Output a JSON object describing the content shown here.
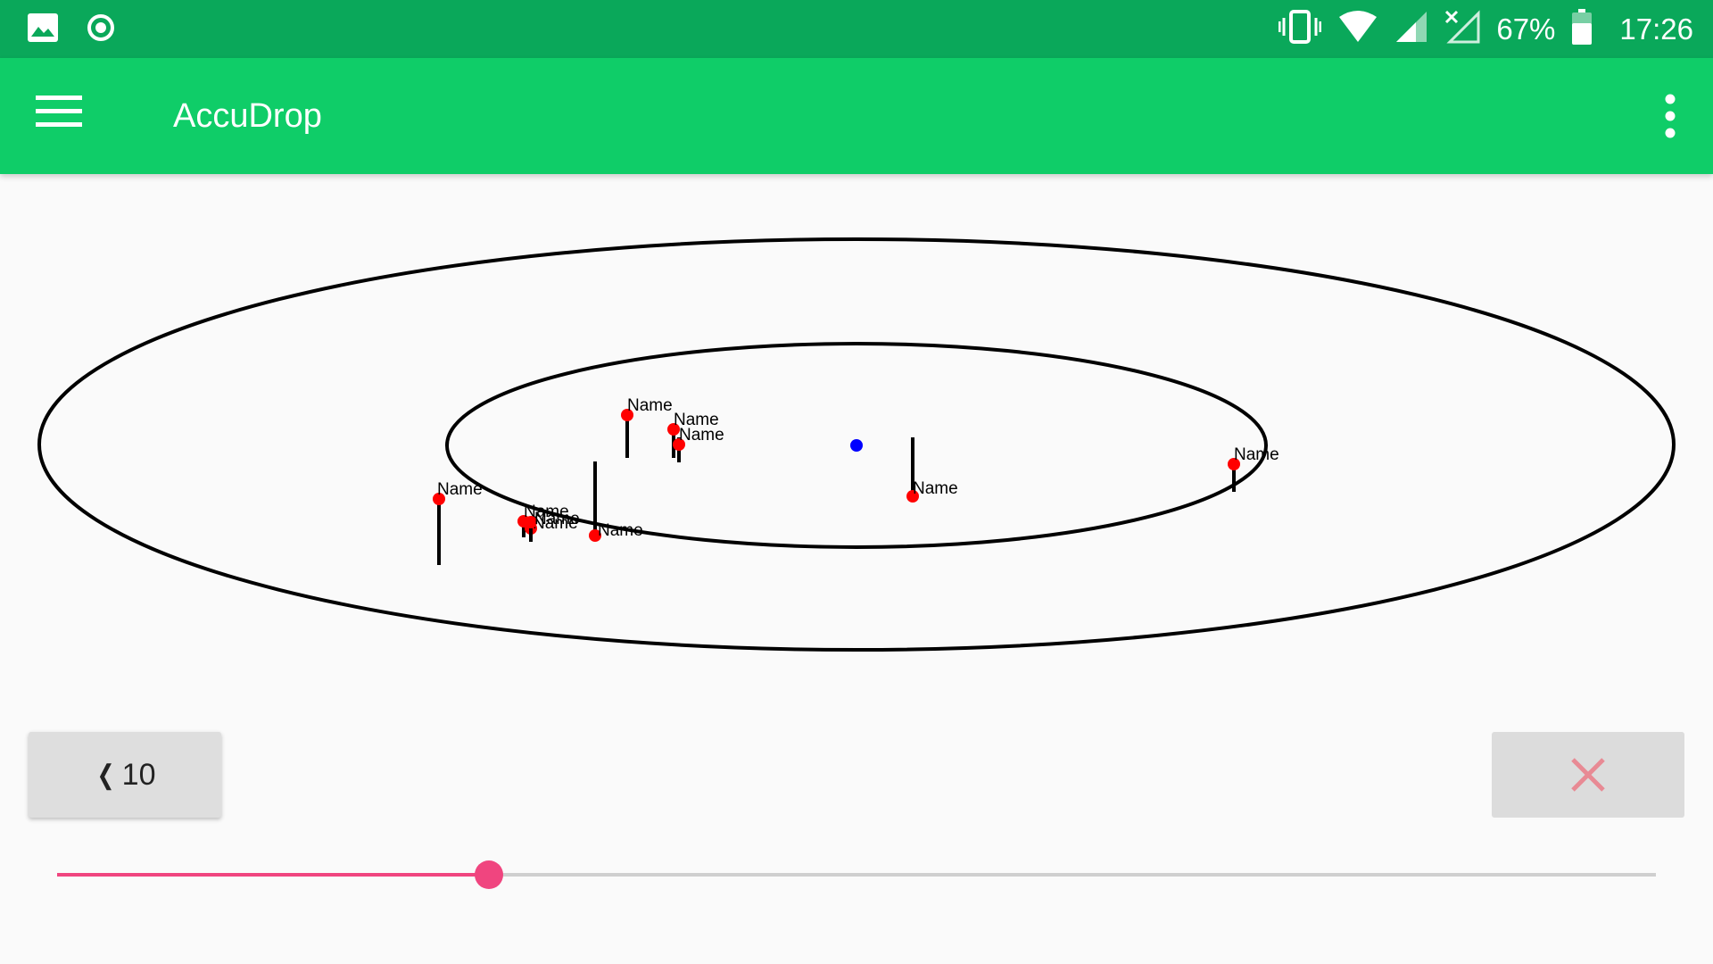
{
  "status_bar": {
    "battery": "67%",
    "time": "17:26",
    "icons": [
      "image-icon",
      "record-icon",
      "vibrate-icon",
      "wifi-icon",
      "cell-signal-icon",
      "no-signal-icon",
      "battery-icon"
    ]
  },
  "app_bar": {
    "title": "AccuDrop",
    "icons": [
      "menu-icon",
      "more-vert-icon"
    ]
  },
  "target": {
    "center_color": "#0000ff",
    "drop_color": "#ff0000",
    "drops": [
      {
        "label": "Name"
      },
      {
        "label": "Name"
      },
      {
        "label": "Name"
      },
      {
        "label": "Name"
      },
      {
        "label": "Name"
      },
      {
        "label": "Name"
      },
      {
        "label": "Name"
      },
      {
        "label": "Name"
      },
      {
        "label": "Name"
      },
      {
        "label": "Name"
      }
    ]
  },
  "controls": {
    "back_label": "10",
    "back_icon": "chevron-left-icon",
    "clear_icon": "close-icon",
    "clear_color": "#e88a94"
  },
  "slider": {
    "value_fraction": 0.27,
    "accent_color": "#f0457f"
  }
}
